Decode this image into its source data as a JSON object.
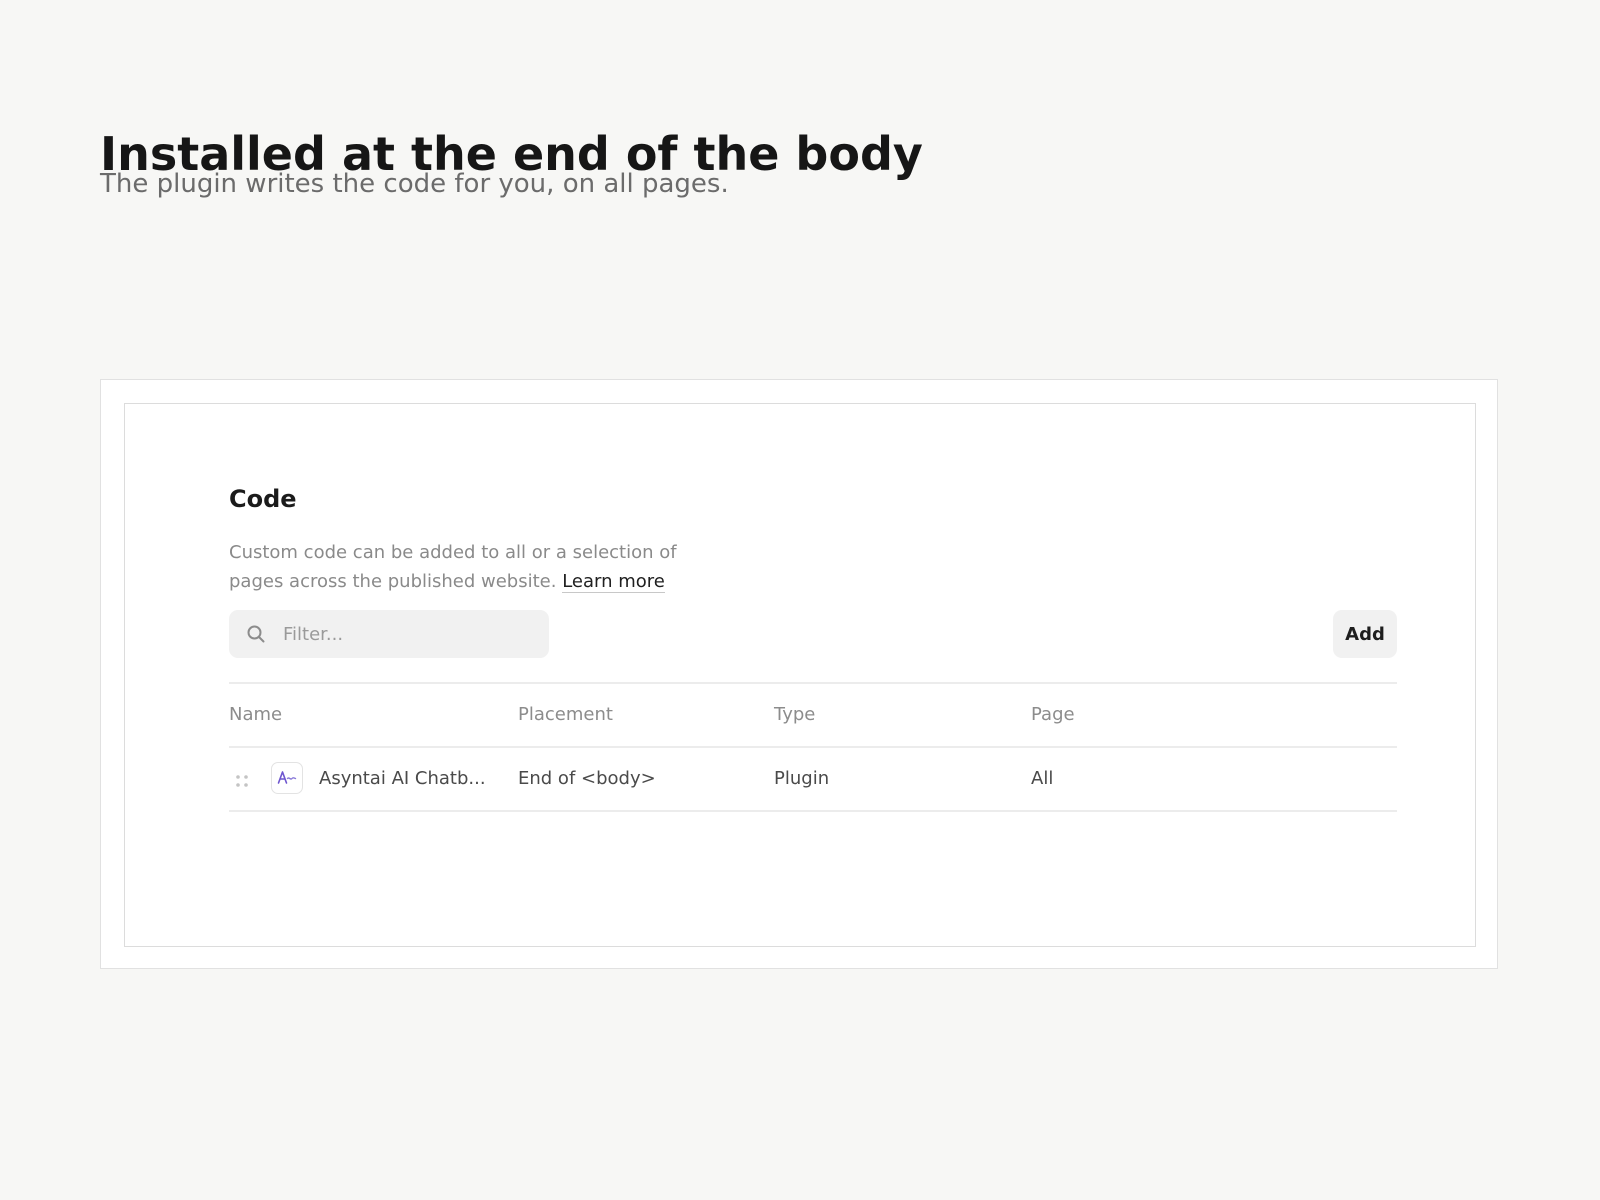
{
  "header": {
    "title": "Installed at the end of the body",
    "subtitle": "The plugin writes the code for you, on all pages."
  },
  "panel": {
    "title": "Code",
    "description": "Custom code can be added to all or a selection of pages across the published website.",
    "learn_more_label": "Learn more",
    "search": {
      "placeholder": "Filter...",
      "value": "",
      "icon": "search-icon"
    },
    "add_label": "Add"
  },
  "table": {
    "columns": [
      "Name",
      "Placement",
      "Type",
      "Page"
    ],
    "rows": [
      {
        "name": "Asyntai AI Chatb...",
        "placement": "End of <body>",
        "type": "Plugin",
        "page": "All",
        "icon": "asyntai-logo-icon"
      }
    ]
  },
  "colors": {
    "background": "#f7f7f5",
    "surface": "#ffffff",
    "field": "#f1f1f1",
    "muted_text": "#8a8a8a",
    "brand_icon": "#6e56cf"
  }
}
